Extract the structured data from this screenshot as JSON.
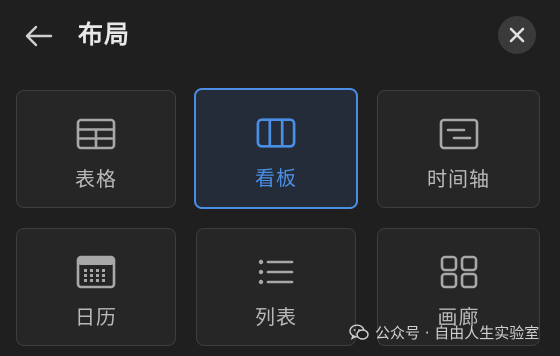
{
  "header": {
    "title": "布局",
    "back_icon": "arrow-left-icon",
    "close_icon": "close-icon"
  },
  "layouts": [
    {
      "label": "表格",
      "icon": "table-icon",
      "selected": false
    },
    {
      "label": "看板",
      "icon": "board-icon",
      "selected": true
    },
    {
      "label": "时间轴",
      "icon": "timeline-icon",
      "selected": false
    },
    {
      "label": "日历",
      "icon": "calendar-icon",
      "selected": false
    },
    {
      "label": "列表",
      "icon": "list-icon",
      "selected": false
    },
    {
      "label": "画廊",
      "icon": "gallery-icon",
      "selected": false
    }
  ],
  "watermark": {
    "text": "公众号 · 自由人生实验室",
    "icon": "wechat-icon"
  },
  "colors": {
    "background": "#1f1f1f",
    "accent": "#4a8ee6",
    "tile_border": "#3e3e3e"
  }
}
